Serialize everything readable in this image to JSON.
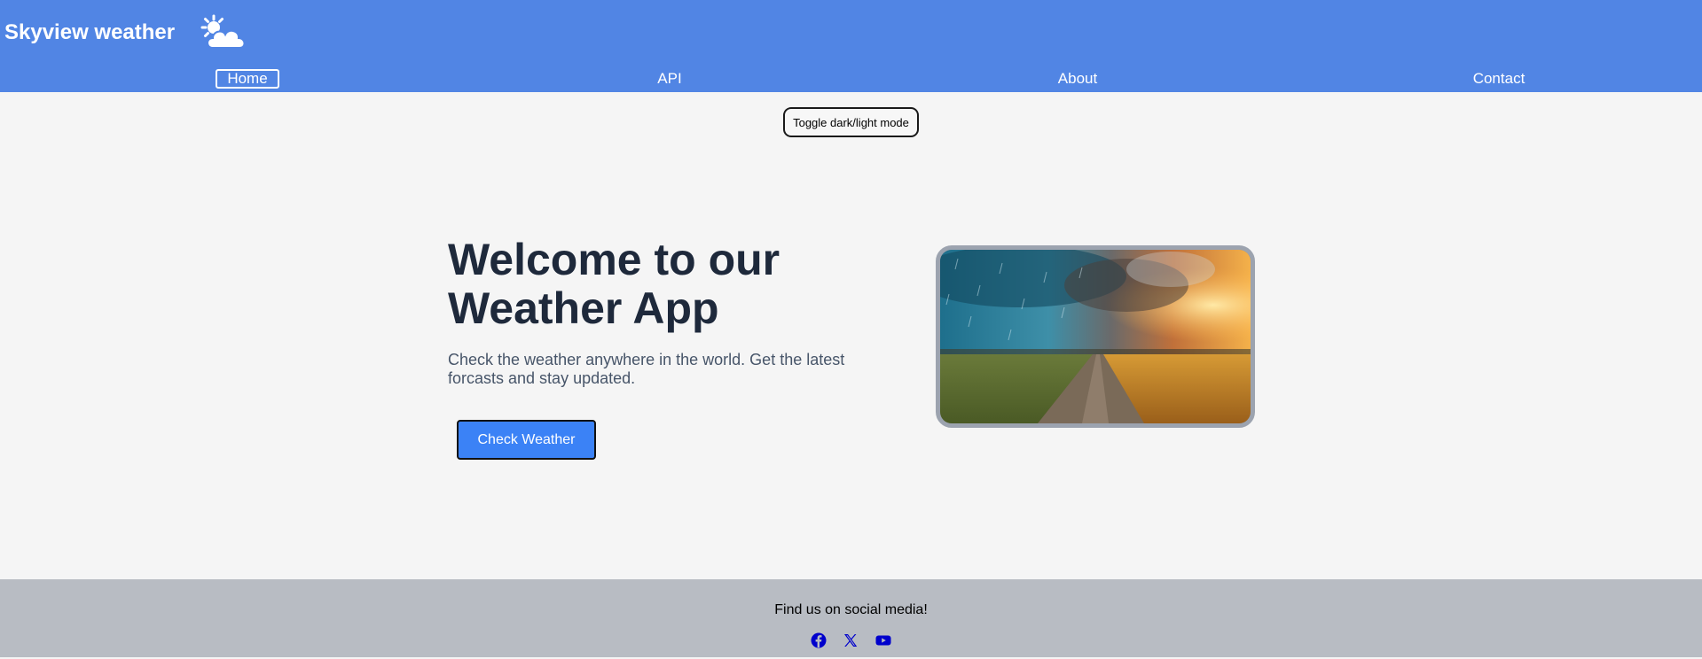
{
  "header": {
    "brand": "Skyview weather",
    "logo_icon": "sun-cloud-icon",
    "nav": [
      "Home",
      "API",
      "About",
      "Contact"
    ],
    "active_nav": "Home"
  },
  "toggle_label": "Toggle dark/light mode",
  "hero": {
    "title": "Welcome to our Weather App",
    "subtitle": "Check the weather anywhere in the world. Get the latest forcasts and stay updated.",
    "cta_label": "Check Weather",
    "image_alt": "stormy sky over wheat field road"
  },
  "footer": {
    "text": "Find us on social media!",
    "icons": [
      "facebook-icon",
      "x-icon",
      "youtube-icon"
    ]
  },
  "colors": {
    "header_bg": "#5185e4",
    "page_bg": "#f5f5f5",
    "cta_bg": "#3b82f6",
    "footer_bg": "#b8bcc3",
    "social_icon": "#0000cc"
  }
}
